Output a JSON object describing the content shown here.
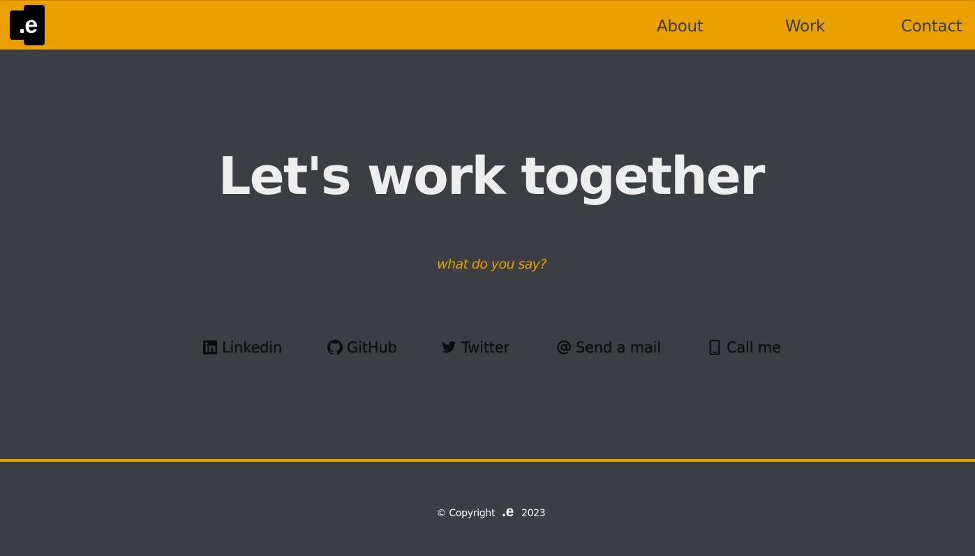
{
  "header": {
    "logo_text": ".e",
    "nav": [
      {
        "label": "About"
      },
      {
        "label": "Work"
      },
      {
        "label": "Contact"
      }
    ],
    "background": "#e9a000"
  },
  "hero": {
    "title": "Let's work together",
    "tagline": "what do you say?",
    "accent": "#e9a000"
  },
  "social_links": [
    {
      "label": "Linkedin",
      "icon": "linkedin-icon"
    },
    {
      "label": "GitHub",
      "icon": "github-icon"
    },
    {
      "label": "Twitter",
      "icon": "twitter-icon"
    },
    {
      "label": "Send a mail",
      "icon": "at-sign-icon"
    },
    {
      "label": "Call me",
      "icon": "phone-icon"
    }
  ],
  "footer": {
    "copyright_prefix": "© Copyright",
    "brand": ".e",
    "year": "2023"
  },
  "colors": {
    "page_background": "#3b3e42",
    "title": "#eeeeee"
  }
}
